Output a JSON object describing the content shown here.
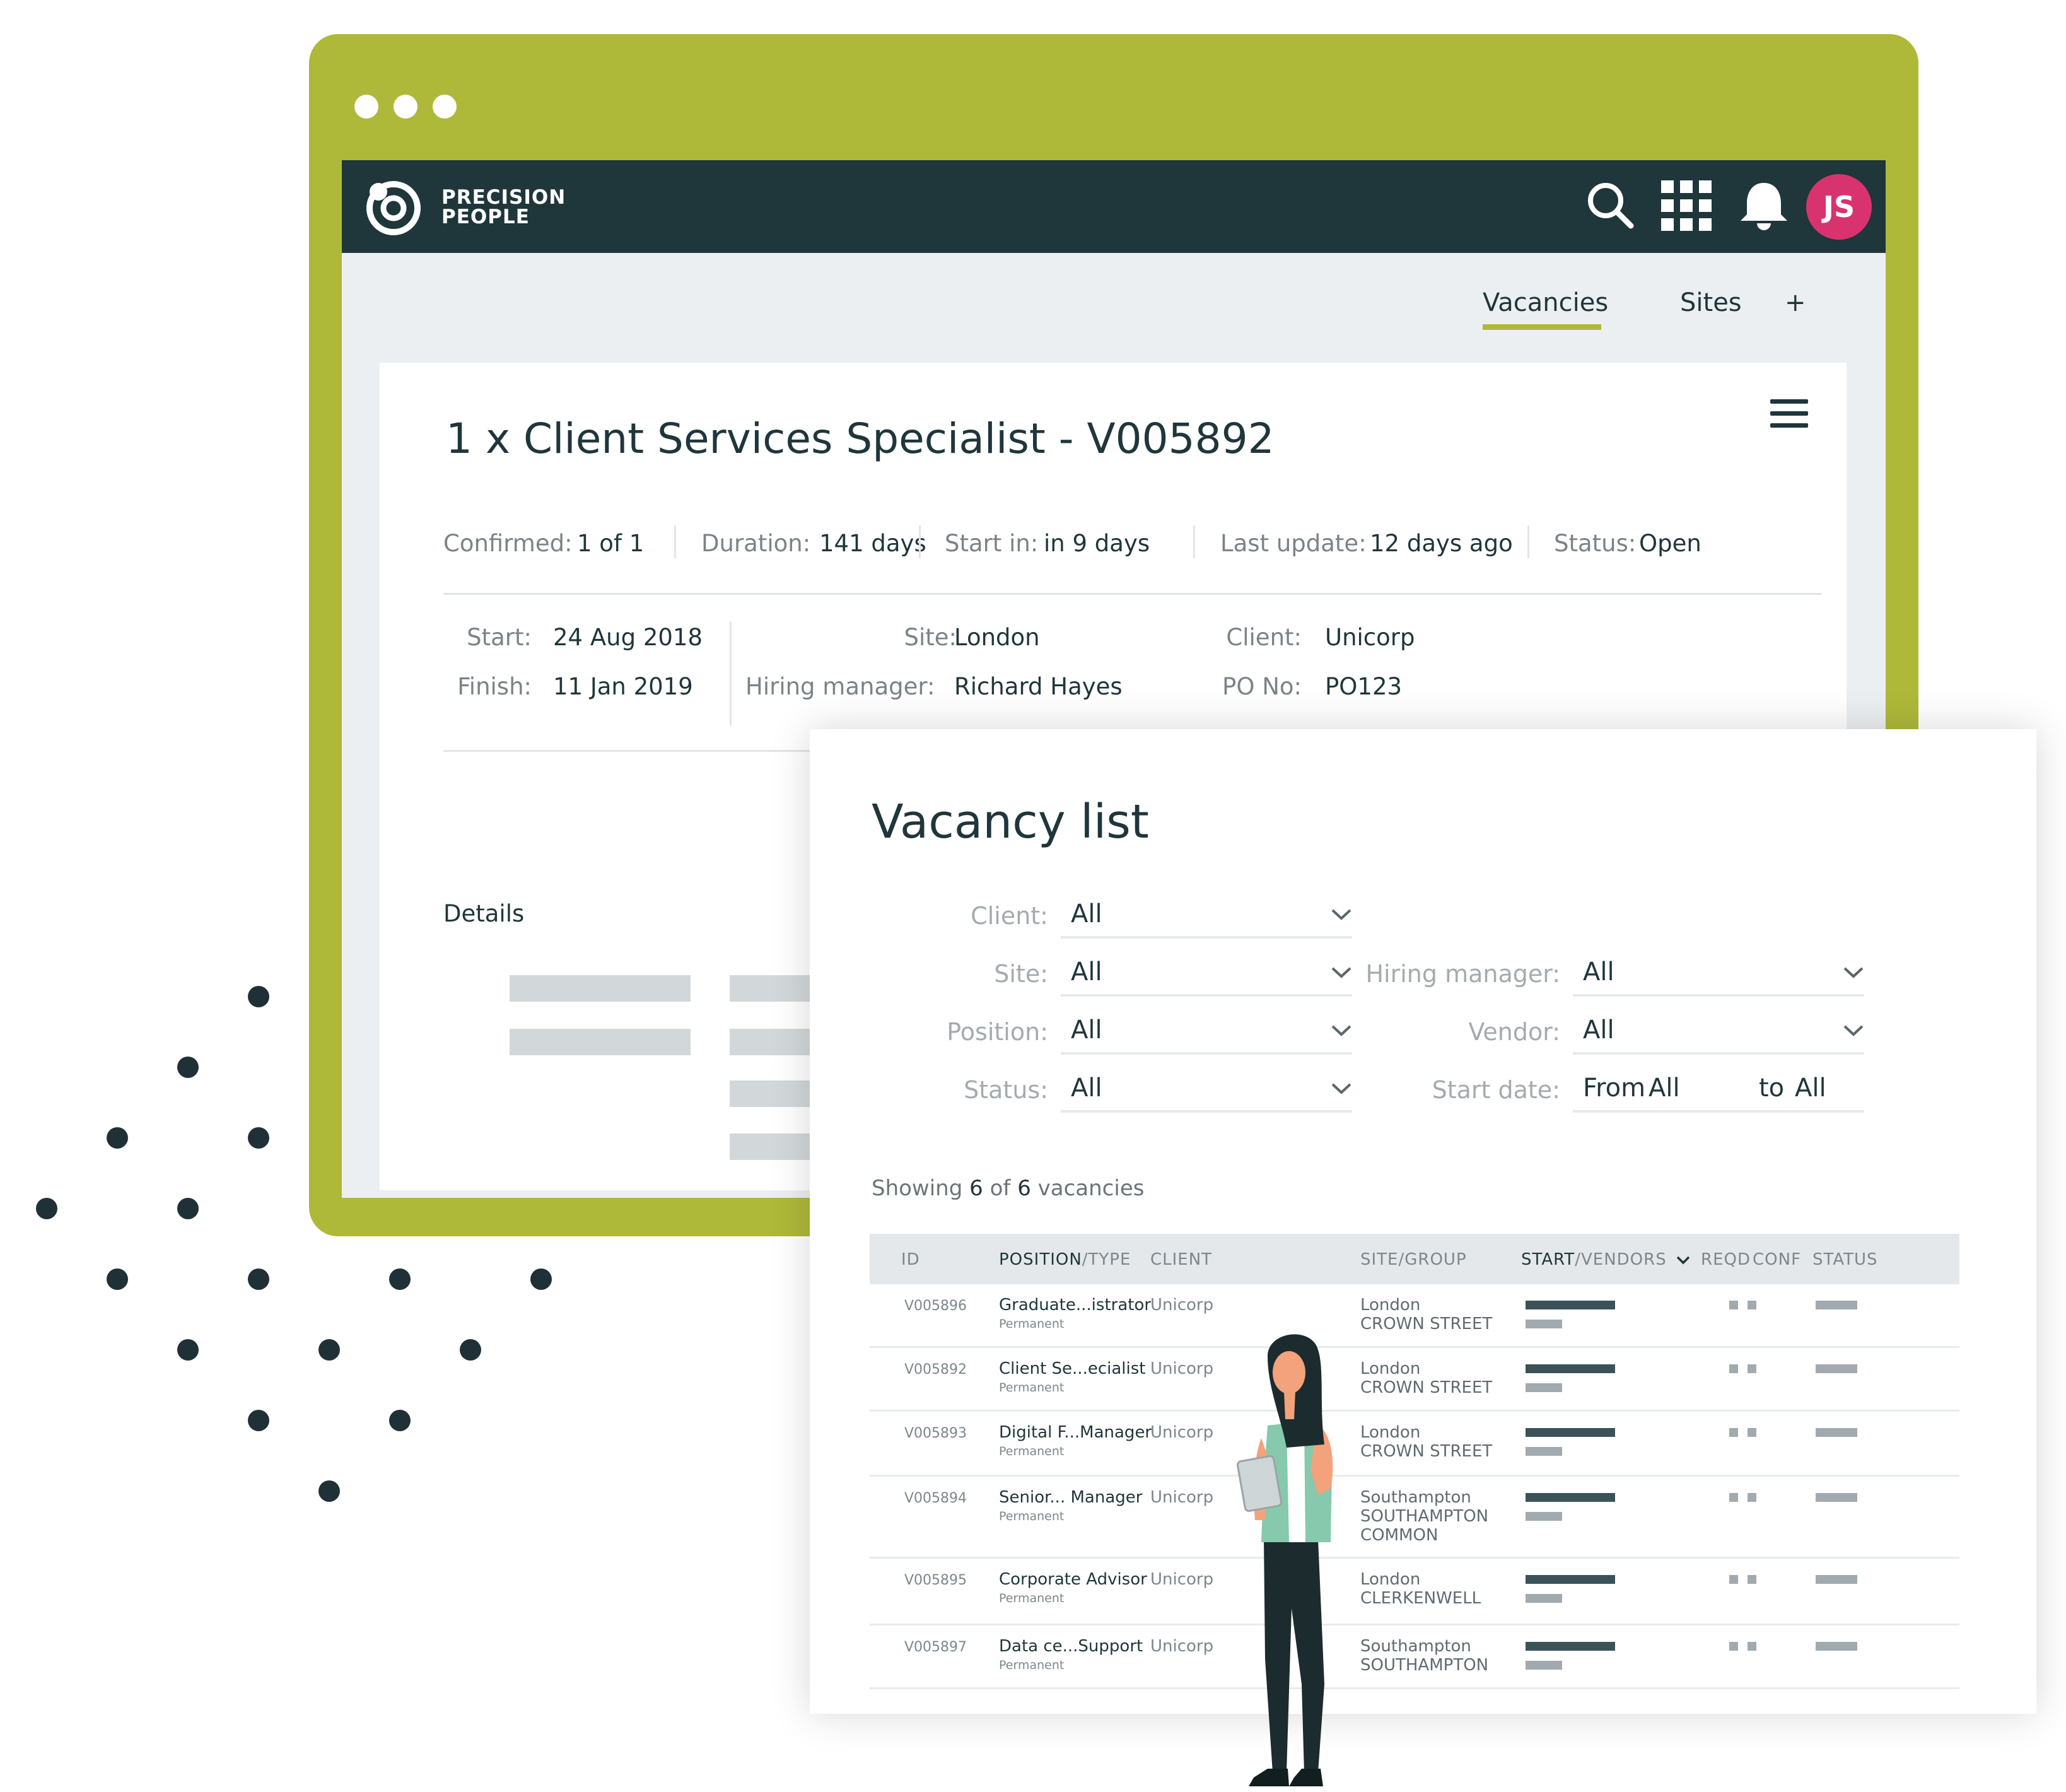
{
  "app": {
    "brand": {
      "line1": "PRECISION",
      "line2": "PEOPLE"
    },
    "user_initials": "JS",
    "colors": {
      "frame": "#aeb93a",
      "appbar": "#1f363b",
      "avatar": "#d8336f"
    },
    "icons": [
      "search-icon",
      "apps-grid-icon",
      "notification-bell-icon"
    ]
  },
  "tabs": [
    {
      "label": "Vacancies",
      "active": true
    },
    {
      "label": "Sites",
      "active": false
    },
    {
      "label": "+",
      "active": false
    }
  ],
  "vacancy": {
    "title": "1 x Client Services Specialist - V005892",
    "summary": [
      {
        "label": "Confirmed:",
        "value": "1 of 1"
      },
      {
        "label": "Duration:",
        "value": "141 days"
      },
      {
        "label": "Start in:",
        "value": "in 9 days"
      },
      {
        "label": "Last update:",
        "value": "12 days ago"
      },
      {
        "label": "Status:",
        "value": "Open"
      }
    ],
    "details": [
      {
        "label": "Start:",
        "value": "24 Aug 2018"
      },
      {
        "label": "Finish:",
        "value": "11 Jan 2019"
      },
      {
        "label": "Site:",
        "value": "London"
      },
      {
        "label": "Hiring manager:",
        "value": "Richard Hayes"
      },
      {
        "label": "Client:",
        "value": "Unicorp"
      },
      {
        "label": "PO No:",
        "value": "PO123"
      }
    ],
    "details_heading": "Details"
  },
  "vacancy_list": {
    "title": "Vacancy list",
    "filters": {
      "client": {
        "label": "Client:",
        "value": "All"
      },
      "site": {
        "label": "Site:",
        "value": "All"
      },
      "position": {
        "label": "Position:",
        "value": "All"
      },
      "status": {
        "label": "Status:",
        "value": "All"
      },
      "hiring_manager": {
        "label": "Hiring manager:",
        "value": "All"
      },
      "vendor": {
        "label": "Vendor:",
        "value": "All"
      },
      "start_date": {
        "label": "Start date:",
        "from_label": "From",
        "from_value": "All",
        "to_label": "to",
        "to_value": "All"
      }
    },
    "showing": {
      "prefix": "Showing",
      "count": "6",
      "of": "of",
      "total": "6",
      "suffix": "vacancies"
    },
    "columns": {
      "id": "ID",
      "position": "POSITION",
      "type": "/TYPE",
      "client": "CLIENT",
      "site": "SITE/GROUP",
      "start": "START",
      "vendors": "/VENDORS",
      "reqd": "REQD",
      "conf": "CONF",
      "status": "STATUS"
    },
    "rows": [
      {
        "id": "V005896",
        "position": "Graduate...istrator",
        "type": "Permanent",
        "client": "Unicorp",
        "site": "London",
        "group": "CROWN STREET"
      },
      {
        "id": "V005892",
        "position": "Client Se...ecialist",
        "type": "Permanent",
        "client": "Unicorp",
        "site": "London",
        "group": "CROWN STREET"
      },
      {
        "id": "V005893",
        "position": "Digital F...Manager",
        "type": "Permanent",
        "client": "Unicorp",
        "site": "London",
        "group": "CROWN STREET"
      },
      {
        "id": "V005894",
        "position": "Senior... Manager",
        "type": "Permanent",
        "client": "Unicorp",
        "site": "Southampton",
        "group": "SOUTHAMPTON COMMON"
      },
      {
        "id": "V005895",
        "position": "Corporate Advisor",
        "type": "Permanent",
        "client": "Unicorp",
        "site": "London",
        "group": "CLERKENWELL"
      },
      {
        "id": "V005897",
        "position": "Data ce...Support",
        "type": "Permanent",
        "client": "Unicorp",
        "site": "Southampton",
        "group": "SOUTHAMPTON"
      }
    ]
  }
}
